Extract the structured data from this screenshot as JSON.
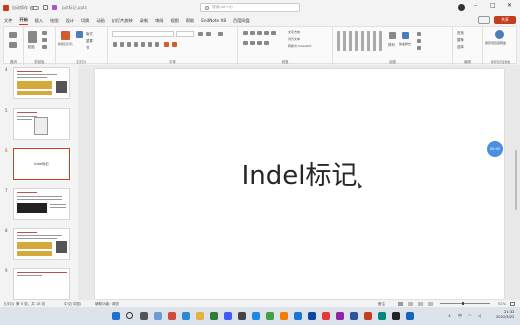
{
  "titlebar": {
    "autosave_label": "自动保存",
    "autosave_state": "关",
    "filename": "ppt标记.pptx",
    "search_placeholder": "搜索(Alt+Q)",
    "minimize": "–",
    "maximize": "□",
    "close": "✕"
  },
  "menu": {
    "tabs": [
      "文件",
      "开始",
      "插入",
      "绘图",
      "设计",
      "切换",
      "动画",
      "幻灯片放映",
      "录制",
      "审阅",
      "视图",
      "帮助",
      "EndNote X8",
      "百度网盘"
    ],
    "active": "开始",
    "share_label": "共享"
  },
  "ribbon": {
    "groups": [
      "撤消",
      "剪贴板",
      "幻灯片",
      "字体",
      "段落",
      "绘图",
      "编辑",
      "保存到百度网盘"
    ],
    "paste": "粘贴",
    "new_slide": "新建幻灯片",
    "reuse_slide": "重用幻灯片",
    "layout": "版式",
    "reset": "重置",
    "section": "节",
    "arrange": "排列",
    "quick_styles": "快速样式",
    "find": "查找",
    "replace": "替换",
    "select": "选择",
    "save_baidu": "保存到百度网盘",
    "text_direction": "文字方向",
    "align_text": "对齐文本",
    "convert_smartart": "转换为 SmartArt"
  },
  "thumbnails": [
    {
      "num": "4"
    },
    {
      "num": "5"
    },
    {
      "num": "6",
      "title": "Indel标记",
      "selected": true
    },
    {
      "num": "7"
    },
    {
      "num": "8"
    },
    {
      "num": "9"
    }
  ],
  "slide": {
    "title": "Indel标记"
  },
  "badge": {
    "text": "00:00"
  },
  "status": {
    "slide_info": "幻灯片 第 6 张，共 16 张",
    "language": "中文(中国)",
    "accessibility": "辅助功能: 调查",
    "notes": "备注",
    "zoom": "52%"
  },
  "taskbar": {
    "time": "21:32",
    "date": "2022/5/22",
    "lang": "中",
    "temp": "ENG"
  },
  "colors": {
    "accent": "#c43e1c",
    "badge": "#4a90e2"
  }
}
